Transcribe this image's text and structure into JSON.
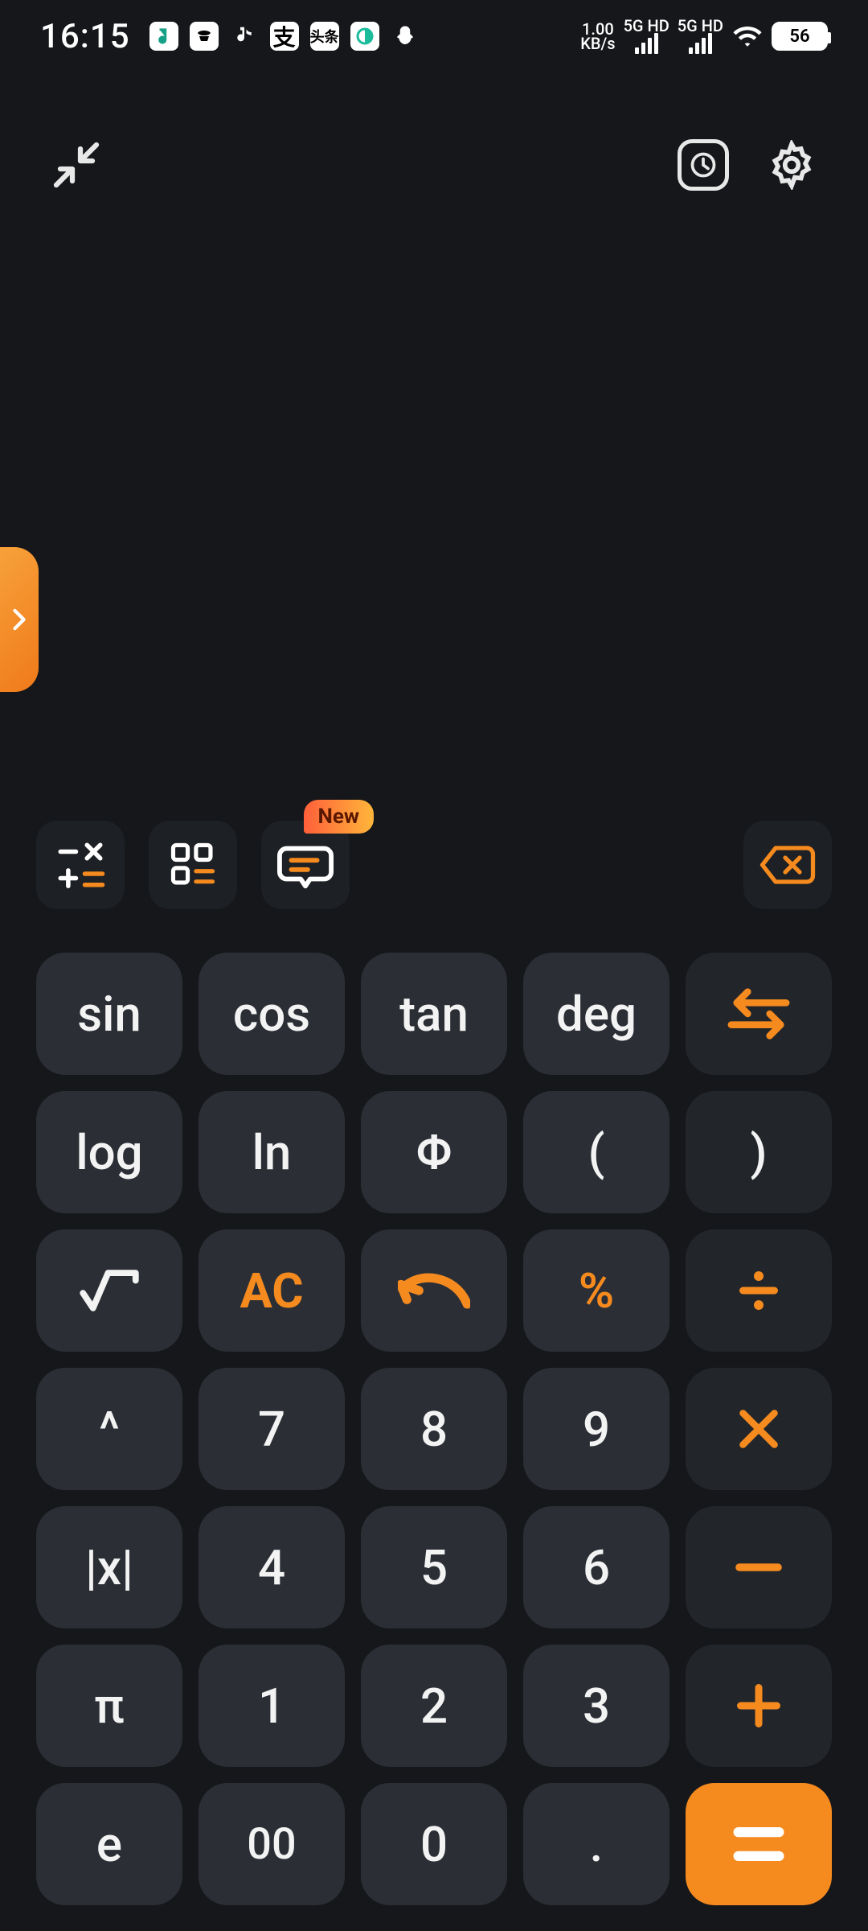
{
  "status": {
    "time": "16:15",
    "net_speed_top": "1.00",
    "net_speed_bottom": "KB/s",
    "sig1_label": "5G HD",
    "sig2_label": "5G HD",
    "battery": "56"
  },
  "tool_row": {
    "new_badge": "New"
  },
  "keys": {
    "r1": {
      "sin": "sin",
      "cos": "cos",
      "tan": "tan",
      "deg": "deg"
    },
    "r2": {
      "log": "log",
      "ln": "ln",
      "phi": "Φ",
      "lparen": "(",
      "rparen": ")"
    },
    "r3": {
      "ac": "AC",
      "percent": "%"
    },
    "r4": {
      "caret": "^",
      "n7": "7",
      "n8": "8",
      "n9": "9"
    },
    "r5": {
      "abs": "|x|",
      "n4": "4",
      "n5": "5",
      "n6": "6"
    },
    "r6": {
      "pi": "π",
      "n1": "1",
      "n2": "2",
      "n3": "3"
    },
    "r7": {
      "e": "e",
      "n00": "00",
      "n0": "0",
      "dot": "."
    }
  }
}
